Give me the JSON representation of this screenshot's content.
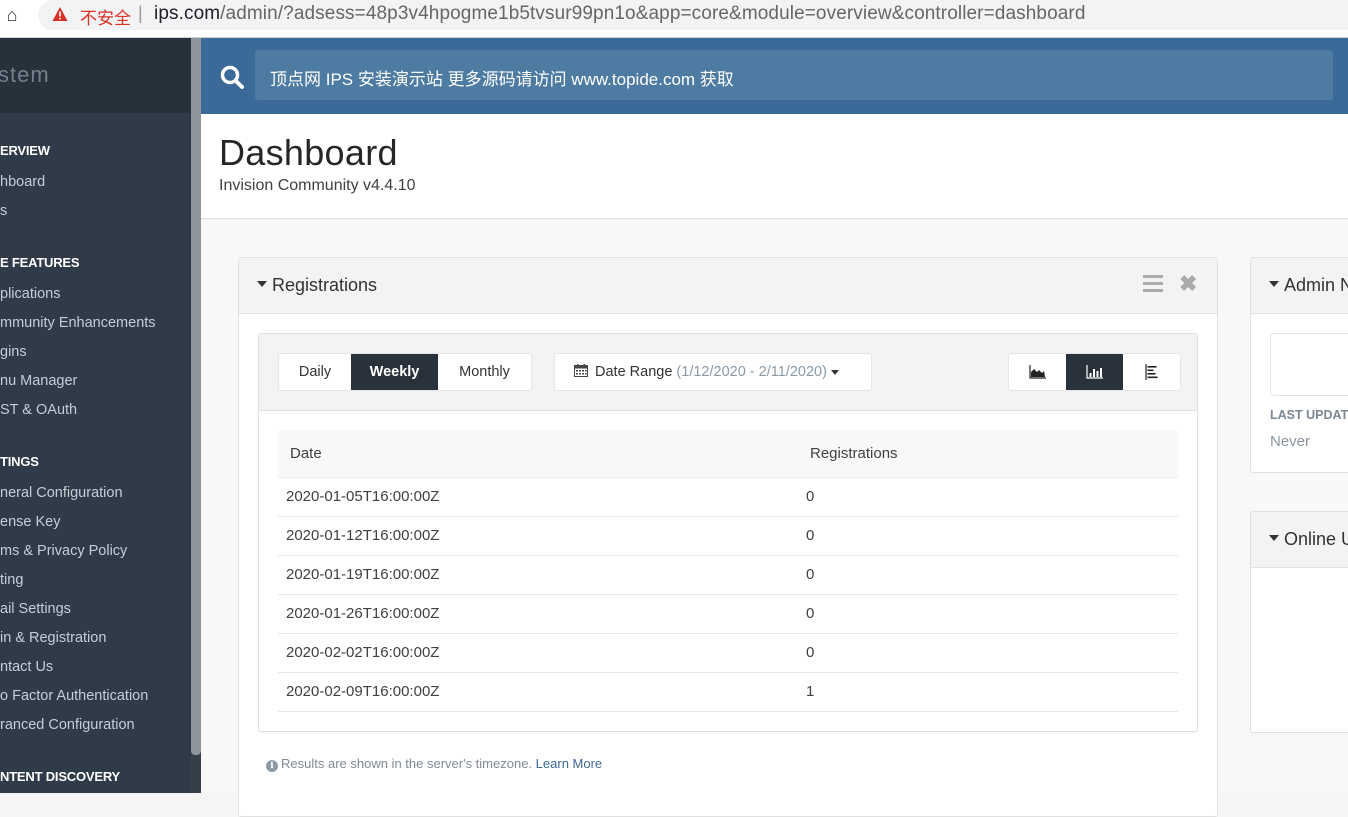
{
  "browser": {
    "security_label": "不安全",
    "url_host": "ips.com",
    "url_path": "/admin/?adsess=48p3v4hpogme1b5tvsur99pn1o&app=core&module=overview&controller=dashboard"
  },
  "sidebar": {
    "brand": "stem",
    "sections": [
      {
        "title": "ERVIEW",
        "items": [
          "hboard",
          "s"
        ]
      },
      {
        "title": "E FEATURES",
        "items": [
          "plications",
          "mmunity Enhancements",
          "gins",
          "nu Manager",
          "ST & OAuth"
        ]
      },
      {
        "title": "TINGS",
        "items": [
          "neral Configuration",
          "ense Key",
          "ms & Privacy Policy",
          "ting",
          "ail Settings",
          "in & Registration",
          "ntact Us",
          "o Factor Authentication",
          "ranced Configuration"
        ]
      },
      {
        "title": "NTENT DISCOVERY",
        "items": []
      }
    ]
  },
  "search": {
    "text": "顶点网 IPS 安装演示站 更多源码请访问 www.topide.com 获取"
  },
  "page": {
    "title": "Dashboard",
    "subtitle": "Invision Community v4.4.10"
  },
  "registrations_widget": {
    "title": "Registrations",
    "periods": [
      {
        "label": "Daily",
        "active": false
      },
      {
        "label": "Weekly",
        "active": true
      },
      {
        "label": "Monthly",
        "active": false
      }
    ],
    "date_range_label": "Date Range",
    "date_range_value": "(1/12/2020 - 2/11/2020)",
    "chart_types": [
      {
        "name": "area-chart-icon",
        "active": false
      },
      {
        "name": "bar-chart-icon",
        "active": true
      },
      {
        "name": "table-view-icon",
        "active": false
      }
    ],
    "table": {
      "headers": [
        "Date",
        "Registrations"
      ],
      "rows": [
        [
          "2020-01-05T16:00:00Z",
          "0"
        ],
        [
          "2020-01-12T16:00:00Z",
          "0"
        ],
        [
          "2020-01-19T16:00:00Z",
          "0"
        ],
        [
          "2020-01-26T16:00:00Z",
          "0"
        ],
        [
          "2020-02-02T16:00:00Z",
          "0"
        ],
        [
          "2020-02-09T16:00:00Z",
          "1"
        ]
      ]
    },
    "footnote": "Results are shown in the server's timezone.",
    "learn_more": "Learn More"
  },
  "admin_widget": {
    "title": "Admin N",
    "last_updated_label": "LAST UPDAT",
    "last_updated_value": "Never"
  },
  "online_widget": {
    "title": "Online U"
  },
  "colors": {
    "header_blue": "#3b6a98",
    "sidebar_bg": "#2f3b48",
    "active_button": "#29323a",
    "link": "#3b6a98"
  }
}
